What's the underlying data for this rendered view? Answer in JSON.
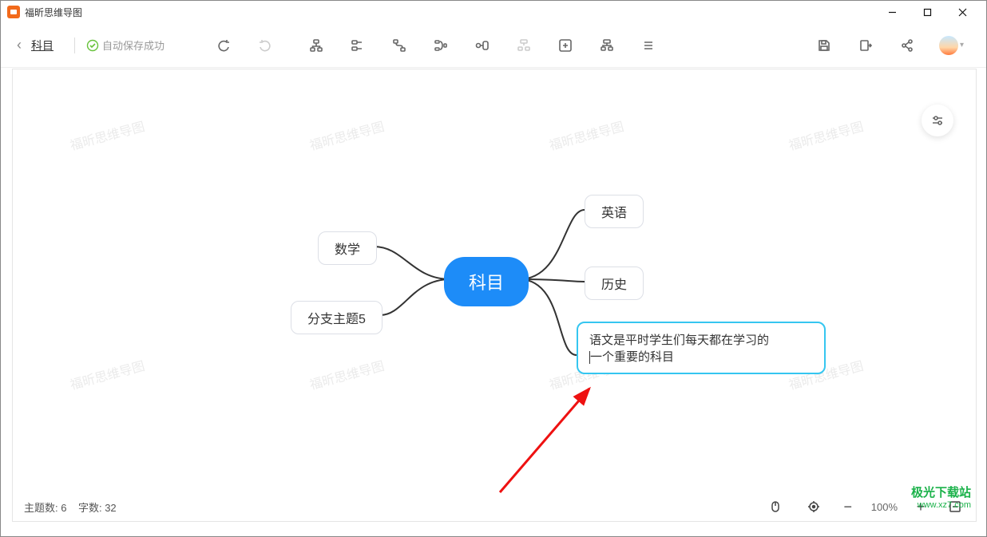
{
  "app": {
    "title": "福昕思维导图"
  },
  "breadcrumb": {
    "label": "科目"
  },
  "autosave": {
    "label": "自动保存成功"
  },
  "toolbar": {
    "undo": "撤销",
    "redo": "重做",
    "t1": "子主题",
    "t2": "同级主题",
    "t3": "关联线",
    "t4": "概要",
    "t5": "边框",
    "t6": "标注",
    "t7": "插入",
    "t8": "格式",
    "t9": "大纲",
    "save": "保存",
    "export": "导出",
    "share": "分享"
  },
  "watermark_text": "福昕思维导图",
  "mindmap": {
    "root": "科目",
    "left": [
      "数学",
      "分支主题5"
    ],
    "right": [
      "英语",
      "历史"
    ],
    "editing": "语文是平时学生们每天都在学习的\n一个重要的科目"
  },
  "status": {
    "topics_label": "主题数:",
    "topics_value": "6",
    "words_label": "字数:",
    "words_value": "32",
    "zoom": "100%"
  },
  "site": {
    "name": "极光下载站",
    "url": "www.xz7.com"
  }
}
